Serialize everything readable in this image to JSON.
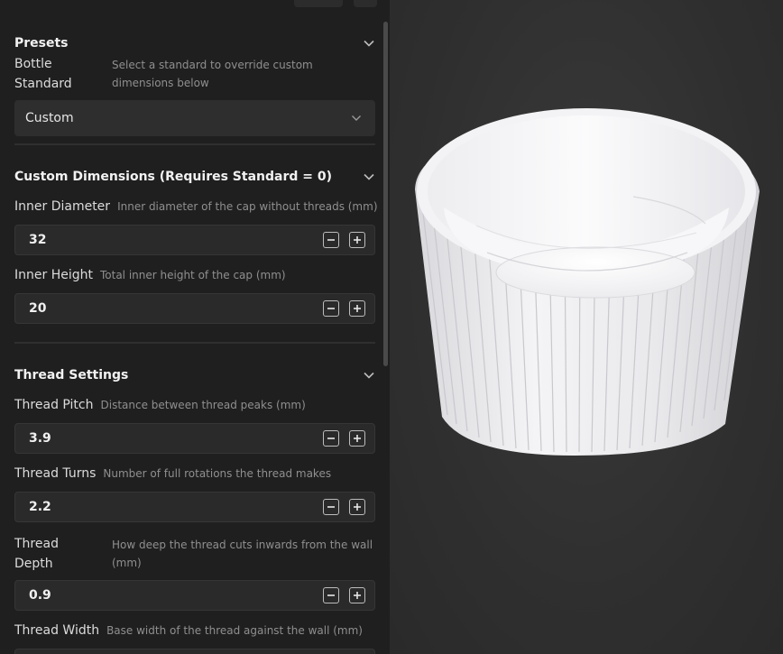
{
  "sections": {
    "presets": {
      "title": "Presets",
      "bottle_standard": {
        "label": "Bottle Standard",
        "description": "Select a standard to override custom dimensions below",
        "value": "Custom"
      }
    },
    "custom_dimensions": {
      "title": "Custom Dimensions (Requires Standard = 0)",
      "inner_diameter": {
        "label": "Inner Diameter",
        "description": "Inner diameter of the cap without threads (mm)",
        "value": "32"
      },
      "inner_height": {
        "label": "Inner Height",
        "description": "Total inner height of the cap (mm)",
        "value": "20"
      }
    },
    "thread_settings": {
      "title": "Thread Settings",
      "thread_pitch": {
        "label": "Thread Pitch",
        "description": "Distance between thread peaks (mm)",
        "value": "3.9"
      },
      "thread_turns": {
        "label": "Thread Turns",
        "description": "Number of full rotations the thread makes",
        "value": "2.2"
      },
      "thread_depth": {
        "label": "Thread Depth",
        "description": "How deep the thread cuts inwards from the wall (mm)",
        "value": "0.9"
      },
      "thread_width": {
        "label": "Thread Width",
        "description": "Base width of the thread against the wall (mm)"
      }
    }
  },
  "icons": {
    "collapse": "chevron-up-icon",
    "dropdown": "chevron-down-icon",
    "decrement": "minus-icon",
    "increment": "plus-icon"
  },
  "colors": {
    "panel_bg": "#1f1f1f",
    "viewport_bg": "#2f2f2f",
    "model": "#f2f2f4"
  }
}
